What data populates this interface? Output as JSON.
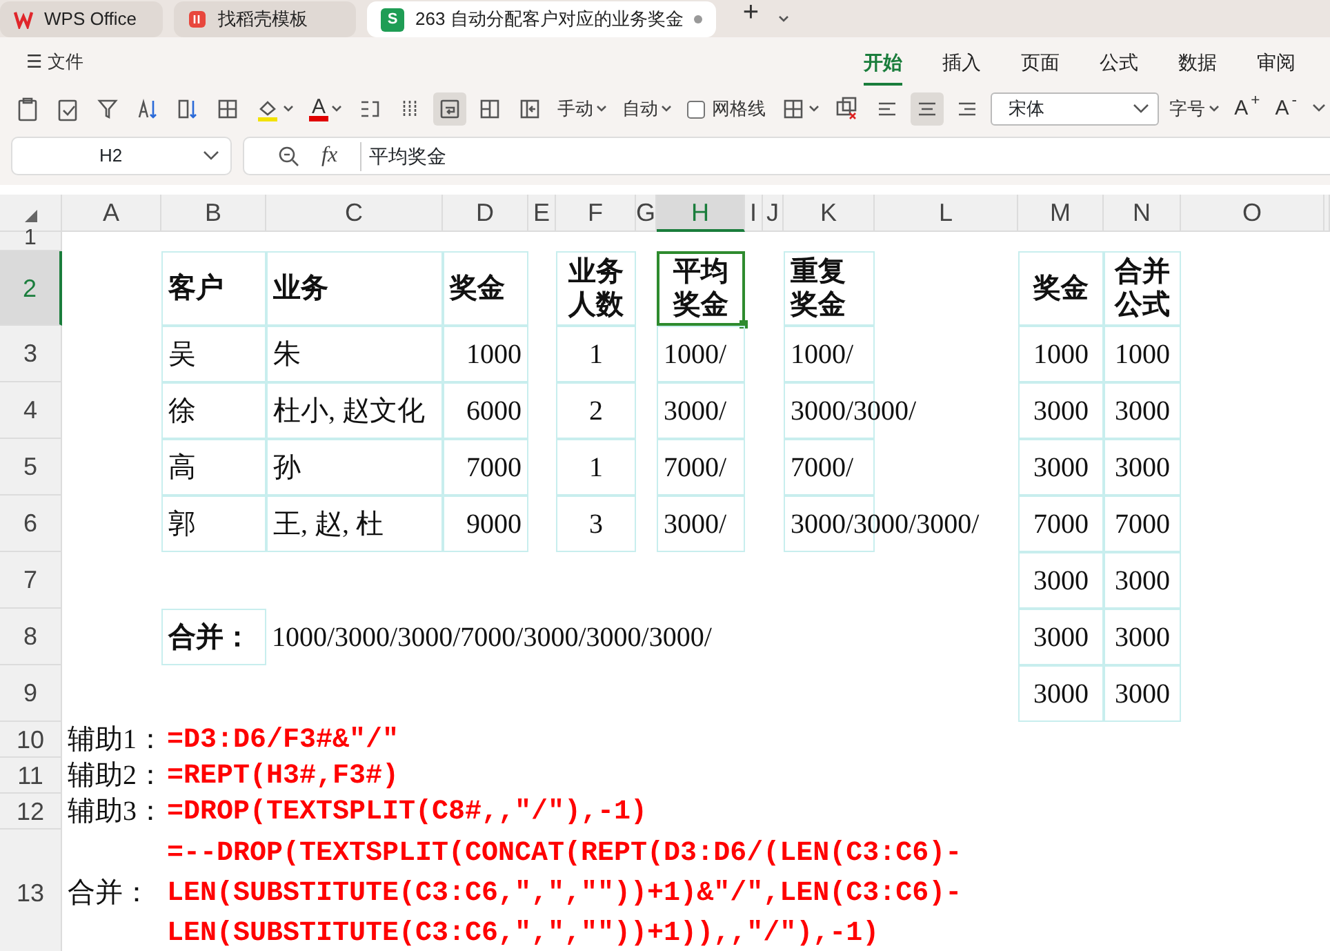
{
  "app_tabs": [
    {
      "kind": "wps",
      "label": "WPS Office",
      "selected": false
    },
    {
      "kind": "template",
      "label": "找稻壳模板",
      "selected": false
    },
    {
      "kind": "sheet",
      "badge": "S",
      "label": "263 自动分配客户对应的业务奖金",
      "selected": true,
      "modified": true
    }
  ],
  "new_tab": "+",
  "file_menu": {
    "icon": "☰",
    "label": "文件"
  },
  "ribbon_tabs": [
    {
      "label": "开始",
      "selected": true
    },
    {
      "label": "插入",
      "selected": false
    },
    {
      "label": "页面",
      "selected": false
    },
    {
      "label": "公式",
      "selected": false
    },
    {
      "label": "数据",
      "selected": false
    },
    {
      "label": "审阅",
      "selected": false
    }
  ],
  "toolbar": [
    {
      "kind": "icon",
      "selected": false
    },
    {
      "kind": "icon",
      "selected": false
    },
    {
      "kind": "icon",
      "selected": false
    },
    {
      "kind": "icon",
      "selected": false
    },
    {
      "kind": "icon",
      "selected": false
    },
    {
      "kind": "icon",
      "selected": false
    },
    {
      "kind": "fill",
      "color": "#f2e200"
    },
    {
      "kind": "fontcolor",
      "text": "A",
      "color": "#e00000"
    },
    {
      "kind": "icon",
      "selected": false
    },
    {
      "kind": "icon",
      "selected": false
    },
    {
      "kind": "icon",
      "selected": true
    },
    {
      "kind": "icon",
      "selected": false
    },
    {
      "kind": "icon",
      "selected": false
    },
    {
      "kind": "dropdown",
      "text": "手动"
    },
    {
      "kind": "dropdown",
      "text": "自动"
    },
    {
      "kind": "checkbox",
      "text": "网格线",
      "checked": false
    },
    {
      "kind": "iconmenu"
    },
    {
      "kind": "icon",
      "selected": false
    },
    {
      "kind": "icon",
      "selected": false
    },
    {
      "kind": "icon",
      "selected": true
    },
    {
      "kind": "icon",
      "selected": false
    },
    {
      "kind": "font",
      "text": "宋体"
    },
    {
      "kind": "dropdown",
      "text": "字号"
    },
    {
      "kind": "text",
      "text": "A$^{+}$"
    },
    {
      "kind": "text",
      "text": "A$^{-}$"
    },
    {
      "kind": "more"
    }
  ],
  "name_box": "H2",
  "fx": "fx",
  "formula": "平均奖金",
  "columns": [
    {
      "label": "A",
      "selected": false
    },
    {
      "label": "B",
      "selected": false
    },
    {
      "label": "C",
      "selected": false
    },
    {
      "label": "D",
      "selected": false
    },
    {
      "label": "E",
      "selected": false
    },
    {
      "label": "F",
      "selected": false
    },
    {
      "label": "G",
      "selected": false
    },
    {
      "label": "H",
      "selected": true
    },
    {
      "label": "I",
      "selected": false
    },
    {
      "label": "J",
      "selected": false
    },
    {
      "label": "K",
      "selected": false
    },
    {
      "label": "L",
      "selected": false
    },
    {
      "label": "M",
      "selected": false
    },
    {
      "label": "N",
      "selected": false
    },
    {
      "label": "O",
      "selected": false
    }
  ],
  "rows": [
    {
      "label": "1",
      "selected": false
    },
    {
      "label": "2",
      "selected": true,
      "cells": {
        "B": {
          "kind": "text",
          "lines": [
            "客户"
          ],
          "bold": true,
          "boxed": true
        },
        "C": {
          "kind": "text",
          "lines": [
            "业务"
          ],
          "bold": true,
          "boxed": true
        },
        "D": {
          "kind": "text",
          "lines": [
            "奖金"
          ],
          "bold": true,
          "boxed": true
        },
        "F": {
          "kind": "centered",
          "lines": [
            "业务",
            "人数"
          ],
          "bold": true,
          "boxed": true
        },
        "H": {
          "kind": "centered",
          "lines": [
            "平均",
            "奖金"
          ],
          "bold": true,
          "boxed": true,
          "selected": true
        },
        "K": {
          "kind": "text",
          "lines": [
            "重复",
            "奖金"
          ],
          "bold": true,
          "boxed": true
        },
        "M": {
          "kind": "centered",
          "lines": [
            "奖金"
          ],
          "bold": true,
          "boxed": true
        },
        "N": {
          "kind": "centered",
          "lines": [
            "合并",
            "公式"
          ],
          "bold": true,
          "boxed": true
        }
      }
    },
    {
      "label": "3",
      "selected": false,
      "cells": {
        "B": {
          "kind": "text",
          "lines": [
            "吴"
          ],
          "boxed": true
        },
        "C": {
          "kind": "text",
          "lines": [
            "朱"
          ],
          "boxed": true
        },
        "D": {
          "kind": "number",
          "lines": [
            "1000"
          ],
          "boxed": true
        },
        "F": {
          "kind": "centered",
          "lines": [
            "1"
          ],
          "boxed": true
        },
        "H": {
          "kind": "text",
          "lines": [
            "1000/"
          ],
          "boxed": true
        },
        "K": {
          "kind": "text",
          "lines": [
            "1000/"
          ],
          "boxed": true
        },
        "M": {
          "kind": "centered",
          "lines": [
            "1000"
          ],
          "boxed": true
        },
        "N": {
          "kind": "centered",
          "lines": [
            "1000"
          ],
          "boxed": true
        }
      }
    },
    {
      "label": "4",
      "selected": false,
      "cells": {
        "B": {
          "kind": "text",
          "lines": [
            "徐"
          ],
          "boxed": true
        },
        "C": {
          "kind": "text",
          "lines": [
            "杜小, 赵文化"
          ],
          "boxed": true
        },
        "D": {
          "kind": "number",
          "lines": [
            "6000"
          ],
          "boxed": true
        },
        "F": {
          "kind": "centered",
          "lines": [
            "2"
          ],
          "boxed": true
        },
        "H": {
          "kind": "text",
          "lines": [
            "3000/"
          ],
          "boxed": true
        },
        "K": {
          "kind": "text",
          "lines": [
            "3000/3000/"
          ],
          "boxed": true
        },
        "M": {
          "kind": "centered",
          "lines": [
            "3000"
          ],
          "boxed": true
        },
        "N": {
          "kind": "centered",
          "lines": [
            "3000"
          ],
          "boxed": true
        }
      }
    },
    {
      "label": "5",
      "selected": false,
      "cells": {
        "B": {
          "kind": "text",
          "lines": [
            "高"
          ],
          "boxed": true
        },
        "C": {
          "kind": "text",
          "lines": [
            "孙"
          ],
          "boxed": true
        },
        "D": {
          "kind": "number",
          "lines": [
            "7000"
          ],
          "boxed": true
        },
        "F": {
          "kind": "centered",
          "lines": [
            "1"
          ],
          "boxed": true
        },
        "H": {
          "kind": "text",
          "lines": [
            "7000/"
          ],
          "boxed": true
        },
        "K": {
          "kind": "text",
          "lines": [
            "7000/"
          ],
          "boxed": true
        },
        "M": {
          "kind": "centered",
          "lines": [
            "3000"
          ],
          "boxed": true
        },
        "N": {
          "kind": "centered",
          "lines": [
            "3000"
          ],
          "boxed": true
        }
      }
    },
    {
      "label": "6",
      "selected": false,
      "cells": {
        "B": {
          "kind": "text",
          "lines": [
            "郭"
          ],
          "boxed": true
        },
        "C": {
          "kind": "text",
          "lines": [
            "王, 赵, 杜"
          ],
          "boxed": true
        },
        "D": {
          "kind": "number",
          "lines": [
            "9000"
          ],
          "boxed": true
        },
        "F": {
          "kind": "centered",
          "lines": [
            "3"
          ],
          "boxed": true
        },
        "H": {
          "kind": "text",
          "lines": [
            "3000/"
          ],
          "boxed": true
        },
        "K": {
          "kind": "text",
          "lines": [
            "3000/3000/3000/"
          ],
          "boxed": true
        },
        "M": {
          "kind": "centered",
          "lines": [
            "7000"
          ],
          "boxed": true
        },
        "N": {
          "kind": "centered",
          "lines": [
            "7000"
          ],
          "boxed": true
        }
      }
    },
    {
      "label": "7",
      "selected": false,
      "cells": {
        "M": {
          "kind": "centered",
          "lines": [
            "3000"
          ],
          "boxed": true
        },
        "N": {
          "kind": "centered",
          "lines": [
            "3000"
          ],
          "boxed": true
        }
      }
    },
    {
      "label": "8",
      "selected": false,
      "cells": {
        "B": {
          "kind": "text",
          "lines": [
            "合并："
          ],
          "bold": true,
          "boxed": true
        },
        "C": {
          "kind": "text",
          "lines": [
            "1000/3000/3000/7000/3000/3000/3000/"
          ]
        },
        "M": {
          "kind": "centered",
          "lines": [
            "3000"
          ],
          "boxed": true
        },
        "N": {
          "kind": "centered",
          "lines": [
            "3000"
          ],
          "boxed": true
        }
      }
    },
    {
      "label": "9",
      "selected": false,
      "cells": {
        "M": {
          "kind": "centered",
          "lines": [
            "3000"
          ],
          "boxed": true
        },
        "N": {
          "kind": "centered",
          "lines": [
            "3000"
          ],
          "boxed": true
        }
      }
    },
    {
      "label": "10",
      "selected": false,
      "cells": {
        "A": {
          "kind": "text",
          "lines": [
            "辅助1："
          ]
        },
        "B": {
          "kind": "formula",
          "lines": [
            "=D3:D6/F3#&\"/\""
          ]
        }
      }
    },
    {
      "label": "11",
      "selected": false,
      "cells": {
        "A": {
          "kind": "text",
          "lines": [
            "辅助2："
          ]
        },
        "B": {
          "kind": "formula",
          "lines": [
            "=REPT(H3#,F3#)"
          ]
        }
      }
    },
    {
      "label": "12",
      "selected": false,
      "cells": {
        "A": {
          "kind": "text",
          "lines": [
            "辅助3："
          ]
        },
        "B": {
          "kind": "formula",
          "lines": [
            "=DROP(TEXTSPLIT(C8#,,\"/\"),-1)"
          ]
        }
      }
    },
    {
      "label": "13",
      "selected": false,
      "cells": {
        "A": {
          "kind": "text",
          "lines": [
            "合并："
          ]
        },
        "B": {
          "kind": "formula",
          "lines": [
            "=--DROP(TEXTSPLIT(CONCAT(REPT(D3:D6/(LEN(C3:C6)-",
            "LEN(SUBSTITUTE(C3:C6,\",\",\"\"))+1)&\"/\",LEN(C3:C6)-",
            "LEN(SUBSTITUTE(C3:C6,\",\",\"\"))+1)),,\"/\"),-1)"
          ]
        }
      }
    }
  ]
}
